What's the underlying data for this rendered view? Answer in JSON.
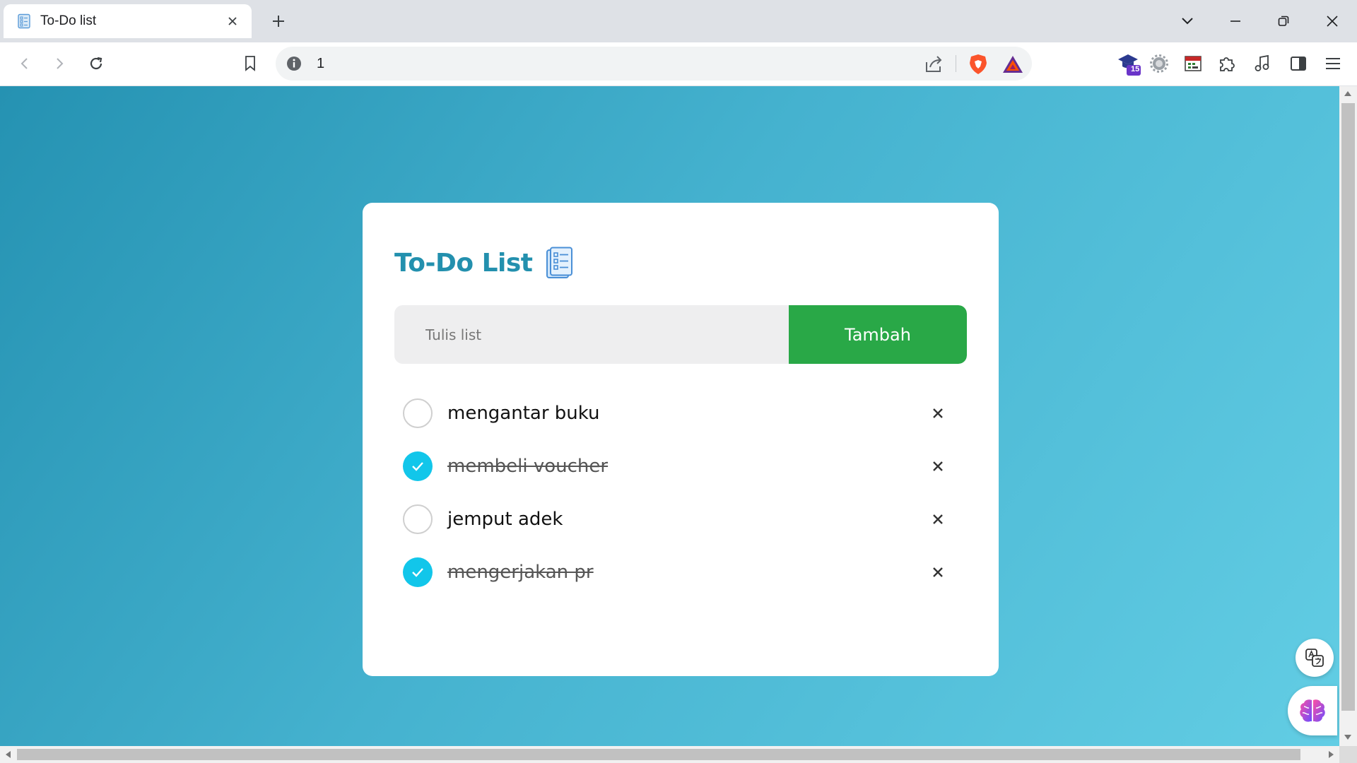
{
  "browser": {
    "tab": {
      "title": "To-Do list",
      "favicon": "checklist-icon"
    },
    "new_tab_icon": "plus-icon",
    "window_controls": [
      "chevron-down-icon",
      "minimize-icon",
      "restore-icon",
      "close-icon"
    ],
    "address": {
      "url": "1",
      "info_icon": "info-icon"
    },
    "toolbar_icons": [
      "back-icon",
      "forward-icon",
      "reload-icon",
      "bookmark-icon",
      "share-icon",
      "brave-shield-icon",
      "bat-rewards-icon"
    ],
    "extensions": {
      "badge": "15",
      "icons": [
        "graduation-cap-icon",
        "gear-extension-icon",
        "calendar-extension-icon",
        "puzzle-icon",
        "music-icon",
        "sidebar-icon",
        "menu-icon"
      ]
    }
  },
  "app": {
    "title": "To-Do List",
    "title_icon": "checklist-icon",
    "input_placeholder": "Tulis list",
    "input_value": "",
    "add_button_label": "Tambah",
    "accent_color": "#2390ae",
    "button_color": "#29a847",
    "checked_color": "#12c6ea",
    "todos": [
      {
        "text": "mengantar buku",
        "done": false
      },
      {
        "text": "membeli voucher",
        "done": true
      },
      {
        "text": "jemput adek",
        "done": false
      },
      {
        "text": "mengerjakan pr",
        "done": true
      }
    ],
    "delete_label": "✕"
  },
  "floating": {
    "translate_icon": "translate-icon",
    "assistant_icon": "brain-icon"
  }
}
